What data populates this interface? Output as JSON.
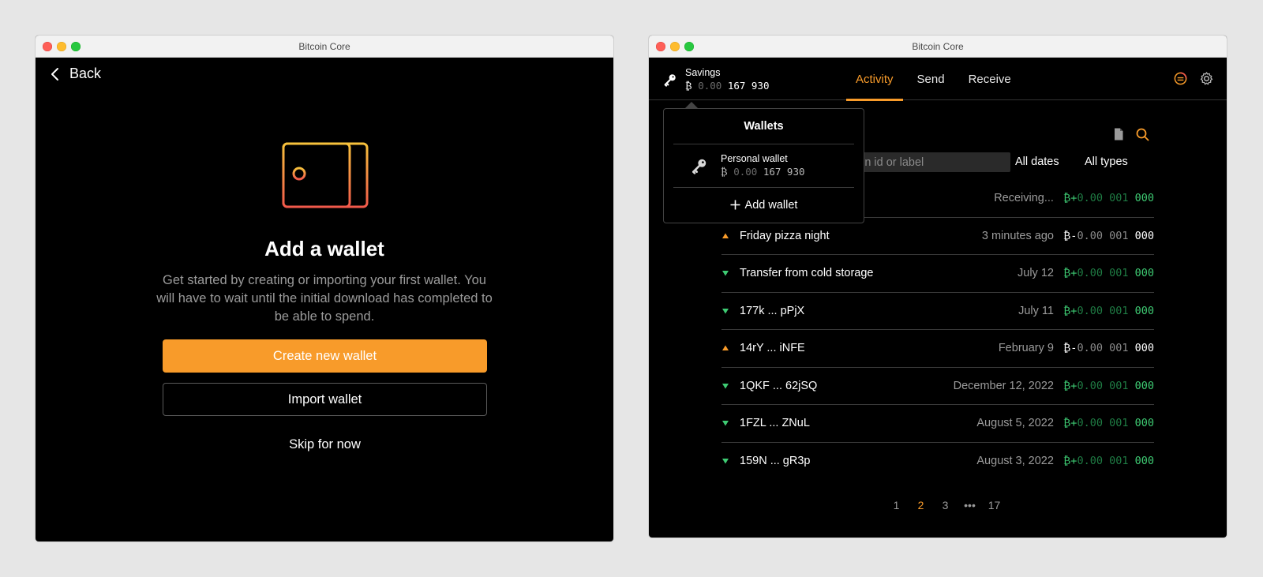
{
  "left_window": {
    "title": "Bitcoin Core",
    "back_label": "Back",
    "heading": "Add a wallet",
    "description": "Get started by creating or importing your first wallet. You will have to wait until the initial download has completed to be able to spend.",
    "create_label": "Create new wallet",
    "import_label": "Import wallet",
    "skip_label": "Skip for now"
  },
  "right_window": {
    "title": "Bitcoin Core",
    "account": {
      "name": "Savings",
      "balance_symbol": "₿",
      "balance_dim": "0.00",
      "balance_main": "167 930"
    },
    "tabs": [
      "Activity",
      "Send",
      "Receive"
    ],
    "active_tab": "Activity",
    "search": {
      "placeholder": "Search by transaction id or label",
      "visible_text": "tion id or label"
    },
    "filters": {
      "dates": "All dates",
      "types": "All types"
    },
    "transactions": [
      {
        "direction": "in",
        "label": "",
        "date": "Receiving...",
        "sign": "+",
        "amt_dim": "0.00 001",
        "amt_main": "000"
      },
      {
        "direction": "out",
        "label": "Friday pizza night",
        "date": "3 minutes ago",
        "sign": "-",
        "amt_dim": "0.00 001",
        "amt_main": "000"
      },
      {
        "direction": "in",
        "label": "Transfer from cold storage",
        "date": "July 12",
        "sign": "+",
        "amt_dim": "0.00 001",
        "amt_main": "000"
      },
      {
        "direction": "in",
        "label": "177k ... pPjX",
        "date": "July 11",
        "sign": "+",
        "amt_dim": "0.00 001",
        "amt_main": "000"
      },
      {
        "direction": "out",
        "label": "14rY ... iNFE",
        "date": "February 9",
        "sign": "-",
        "amt_dim": "0.00 001",
        "amt_main": "000"
      },
      {
        "direction": "in",
        "label": "1QKF ... 62jSQ",
        "date": "December 12, 2022",
        "sign": "+",
        "amt_dim": "0.00 001",
        "amt_main": "000"
      },
      {
        "direction": "in",
        "label": "1FZL ... ZNuL",
        "date": "August 5, 2022",
        "sign": "+",
        "amt_dim": "0.00 001",
        "amt_main": "000"
      },
      {
        "direction": "in",
        "label": "159N ... gR3p",
        "date": "August 3, 2022",
        "sign": "+",
        "amt_dim": "0.00 001",
        "amt_main": "000"
      }
    ],
    "pagination": [
      "1",
      "2",
      "3",
      "•••",
      "17"
    ],
    "active_page": "2",
    "wallets_popup": {
      "title": "Wallets",
      "wallet_name": "Personal wallet",
      "wallet_balance_symbol": "₿",
      "wallet_balance_dim": "0.00",
      "wallet_balance_main": "167 930",
      "add_label": "Add wallet"
    }
  },
  "colors": {
    "accent": "#f89b2a",
    "positive": "#3ecb73",
    "background": "#000000",
    "desktop": "#e6e6e6"
  },
  "icons": {
    "back": "chevron-left-icon",
    "wallet_illustration": "wallet-icon",
    "account": "key-icon",
    "sync": "sync-status-icon",
    "settings": "gear-icon",
    "export": "document-icon",
    "search": "search-icon",
    "add": "plus-icon"
  }
}
